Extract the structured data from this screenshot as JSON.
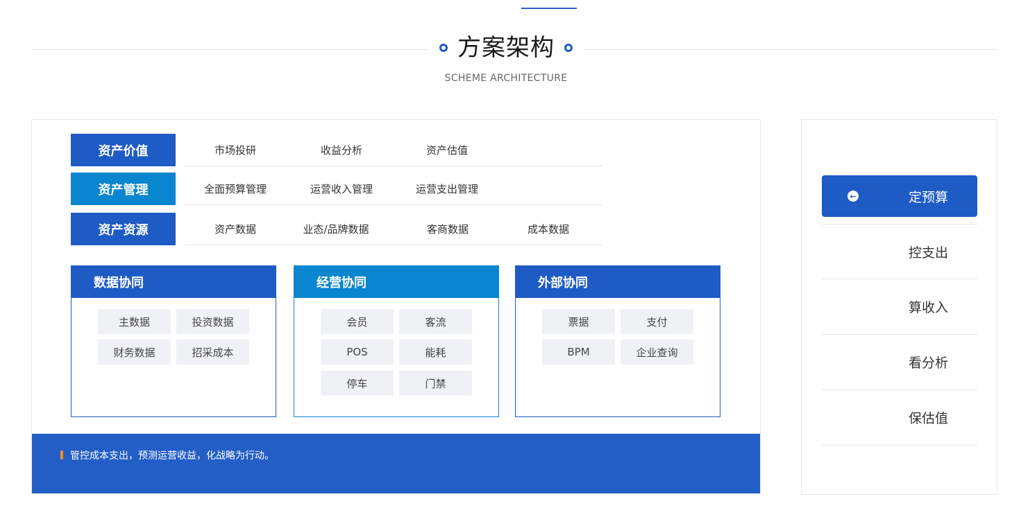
{
  "header": {
    "title": "方案架构",
    "subtitle": "SCHEME ARCHITECTURE"
  },
  "layers": [
    {
      "label": "资产价值",
      "color": "#1f5bc4",
      "items": [
        "市场投研",
        "收益分析",
        "资产估值"
      ]
    },
    {
      "label": "资产管理",
      "color": "#0a85cf",
      "items": [
        "全面预算管理",
        "运营收入管理",
        "运营支出管理"
      ]
    },
    {
      "label": "资产资源",
      "color": "#1f5bc4",
      "items": [
        "资产数据",
        "业态/品牌数据",
        "客商数据",
        "成本数据"
      ]
    }
  ],
  "boxes": [
    {
      "title": "数据协同",
      "color": "#1f5bc4",
      "chips": [
        "主数据",
        "投资数据",
        "财务数据",
        "招采成本"
      ]
    },
    {
      "title": "经营协同",
      "color": "#0a85cf",
      "chips": [
        "会员",
        "客流",
        "POS",
        "能耗",
        "停车",
        "门禁"
      ]
    },
    {
      "title": "外部协同",
      "color": "#1f5bc4",
      "chips": [
        "票据",
        "支付",
        "BPM",
        "企业查询"
      ]
    }
  ],
  "footer": {
    "text": "管控成本支出，预测运营收益，化战略为行动。",
    "accent_color": "#ff8a1f",
    "bg_color": "#235ec6"
  },
  "sidebar": {
    "active_index": 0,
    "active_icon": "arrow-left-circle-icon",
    "items": [
      "定预算",
      "控支出",
      "算收入",
      "看分析",
      "保估值"
    ]
  }
}
